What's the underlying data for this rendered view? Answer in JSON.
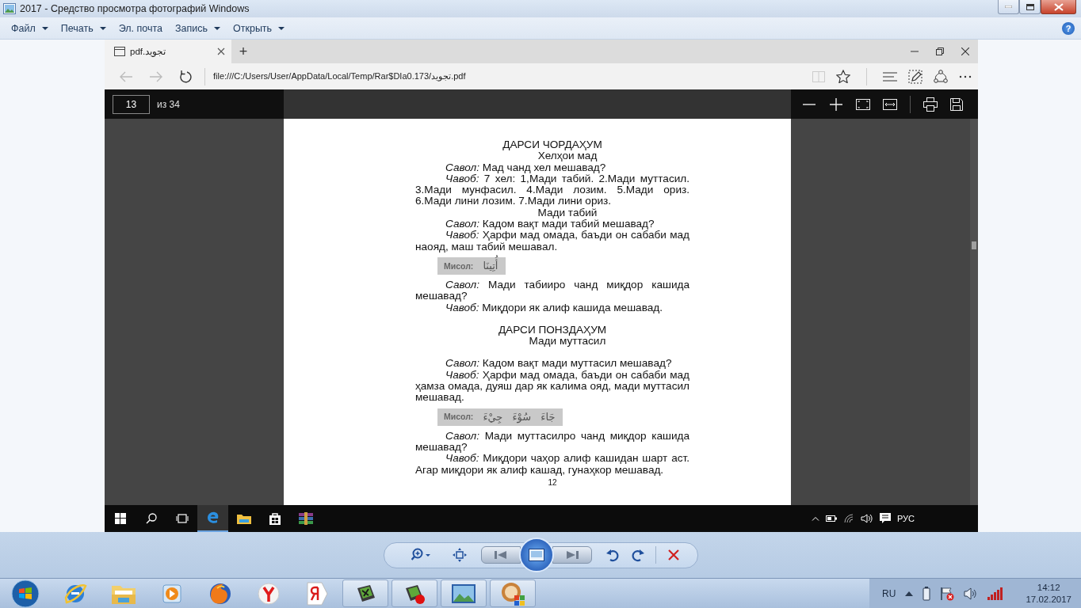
{
  "window": {
    "title": "2017 - Средство просмотра фотографий Windows"
  },
  "menu": [
    {
      "label": "Файл",
      "dropdown": true
    },
    {
      "label": "Печать",
      "dropdown": true
    },
    {
      "label": "Эл. почта",
      "dropdown": false
    },
    {
      "label": "Запись",
      "dropdown": true
    },
    {
      "label": "Открыть",
      "dropdown": true
    }
  ],
  "help": {
    "label": "?"
  },
  "browser": {
    "tab": {
      "title": "pdf.تجوید"
    },
    "new_tab": "+",
    "back_disabled": true,
    "forward_disabled": true,
    "reading_view_disabled": true,
    "address": "file:///C:/Users/User/AppData/Local/Temp/Rar$DIa0.173/تجوید.pdf"
  },
  "pdf_toolbar": {
    "page": "13",
    "total": "из 34"
  },
  "document": {
    "lessons": [
      {
        "title": "ДАРСИ ЧОРДАҲУМ",
        "subtitle": "Хелҳои мад",
        "spaced": false,
        "items": [
          {
            "kind": "para",
            "text": "*Савол:* Мад чанд хел мешавад?"
          },
          {
            "kind": "para",
            "text": "*Чавоб:* 7 хел: 1,Мади табий. 2.Мади муттасил. 3.Мади мунфасил. 4.Мади лозим. 5.Мади ориз. 6.Мади лини лозим. 7.Мади лини ориз."
          },
          {
            "kind": "subheading",
            "text": "Мади табий"
          },
          {
            "kind": "para",
            "text": "*Савол:* Кадом вақт мади табий мешавад?"
          },
          {
            "kind": "para",
            "text": "*Чавоб:* Ҳарфи мад омада, баъди он сабаби мад наояд, маш табий мешавал."
          },
          {
            "kind": "example",
            "label": "Мисол:",
            "arabic": "أُتِينَا"
          },
          {
            "kind": "para",
            "text": "*Савол:* Мади табииро чанд миқдор кашида мешавад?"
          },
          {
            "kind": "para",
            "text": "*Чавоб:* Миқдори як алиф кашида мешавад."
          }
        ]
      },
      {
        "title": "ДАРСИ ПОНЗДАҲУМ",
        "subtitle": "Мади муттасил",
        "spaced": true,
        "items": [
          {
            "kind": "para",
            "text": "*Савол:* Кадом вақт мади муттасил мешавад?"
          },
          {
            "kind": "para",
            "text": "*Чавоб:* Ҳарфи мад омада, баъди он сабаби мад ҳамза омада, дуяш дар як калима ояд, мади муттасил мешавад."
          },
          {
            "kind": "example",
            "label": "Мисол:",
            "arabic": "جَاءَ سُوْءَ جِيْءَ"
          },
          {
            "kind": "para",
            "text": "*Савол:* Мади муттасилро чанд миқдор кашида мешавад?"
          },
          {
            "kind": "para",
            "text": "*Чавоб:* Миқдори чаҳор алиф кашидан шарт аст. Агар миқдори як алиф кашад, гунаҳкор мешавад."
          }
        ]
      }
    ],
    "page_number": "12"
  },
  "inner_taskbar": {
    "items": [
      {
        "active": false
      },
      {
        "active": false
      },
      {
        "active": false
      },
      {
        "active": true
      },
      {
        "active": false
      },
      {
        "active": false
      },
      {
        "active": false
      }
    ],
    "language": "РУС"
  },
  "taskbar": {
    "items": [
      {
        "running": false
      },
      {
        "running": false
      },
      {
        "running": false
      },
      {
        "running": false
      },
      {
        "running": false
      },
      {
        "running": false
      },
      {
        "running": true
      },
      {
        "running": true
      },
      {
        "running": true
      },
      {
        "running": true
      }
    ],
    "language": "RU",
    "time": "14:12",
    "date": "17.02.2017"
  }
}
